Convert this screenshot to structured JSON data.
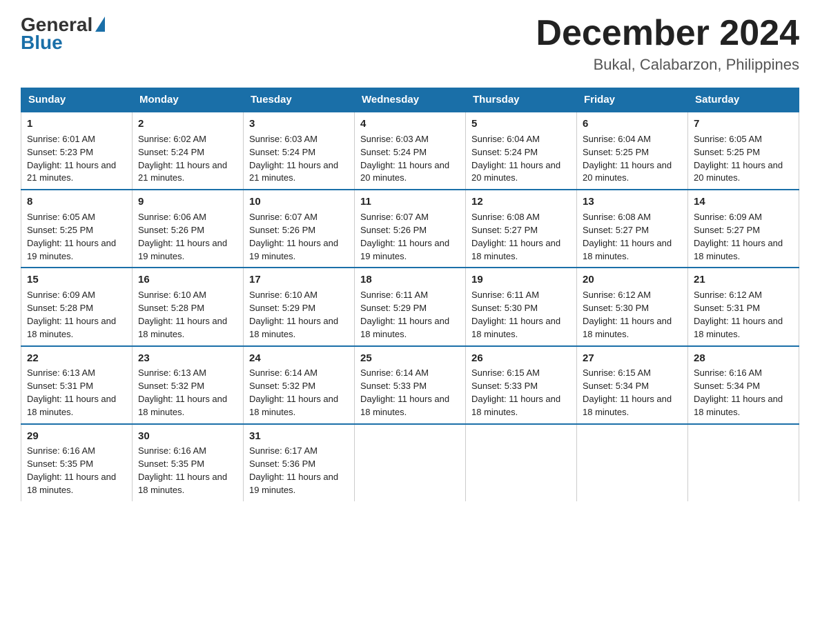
{
  "logo": {
    "general": "General",
    "blue": "Blue"
  },
  "title": {
    "month_year": "December 2024",
    "location": "Bukal, Calabarzon, Philippines"
  },
  "days_of_week": [
    "Sunday",
    "Monday",
    "Tuesday",
    "Wednesday",
    "Thursday",
    "Friday",
    "Saturday"
  ],
  "weeks": [
    [
      {
        "day": 1,
        "sunrise": "6:01 AM",
        "sunset": "5:23 PM",
        "daylight": "11 hours and 21 minutes."
      },
      {
        "day": 2,
        "sunrise": "6:02 AM",
        "sunset": "5:24 PM",
        "daylight": "11 hours and 21 minutes."
      },
      {
        "day": 3,
        "sunrise": "6:03 AM",
        "sunset": "5:24 PM",
        "daylight": "11 hours and 21 minutes."
      },
      {
        "day": 4,
        "sunrise": "6:03 AM",
        "sunset": "5:24 PM",
        "daylight": "11 hours and 20 minutes."
      },
      {
        "day": 5,
        "sunrise": "6:04 AM",
        "sunset": "5:24 PM",
        "daylight": "11 hours and 20 minutes."
      },
      {
        "day": 6,
        "sunrise": "6:04 AM",
        "sunset": "5:25 PM",
        "daylight": "11 hours and 20 minutes."
      },
      {
        "day": 7,
        "sunrise": "6:05 AM",
        "sunset": "5:25 PM",
        "daylight": "11 hours and 20 minutes."
      }
    ],
    [
      {
        "day": 8,
        "sunrise": "6:05 AM",
        "sunset": "5:25 PM",
        "daylight": "11 hours and 19 minutes."
      },
      {
        "day": 9,
        "sunrise": "6:06 AM",
        "sunset": "5:26 PM",
        "daylight": "11 hours and 19 minutes."
      },
      {
        "day": 10,
        "sunrise": "6:07 AM",
        "sunset": "5:26 PM",
        "daylight": "11 hours and 19 minutes."
      },
      {
        "day": 11,
        "sunrise": "6:07 AM",
        "sunset": "5:26 PM",
        "daylight": "11 hours and 19 minutes."
      },
      {
        "day": 12,
        "sunrise": "6:08 AM",
        "sunset": "5:27 PM",
        "daylight": "11 hours and 18 minutes."
      },
      {
        "day": 13,
        "sunrise": "6:08 AM",
        "sunset": "5:27 PM",
        "daylight": "11 hours and 18 minutes."
      },
      {
        "day": 14,
        "sunrise": "6:09 AM",
        "sunset": "5:27 PM",
        "daylight": "11 hours and 18 minutes."
      }
    ],
    [
      {
        "day": 15,
        "sunrise": "6:09 AM",
        "sunset": "5:28 PM",
        "daylight": "11 hours and 18 minutes."
      },
      {
        "day": 16,
        "sunrise": "6:10 AM",
        "sunset": "5:28 PM",
        "daylight": "11 hours and 18 minutes."
      },
      {
        "day": 17,
        "sunrise": "6:10 AM",
        "sunset": "5:29 PM",
        "daylight": "11 hours and 18 minutes."
      },
      {
        "day": 18,
        "sunrise": "6:11 AM",
        "sunset": "5:29 PM",
        "daylight": "11 hours and 18 minutes."
      },
      {
        "day": 19,
        "sunrise": "6:11 AM",
        "sunset": "5:30 PM",
        "daylight": "11 hours and 18 minutes."
      },
      {
        "day": 20,
        "sunrise": "6:12 AM",
        "sunset": "5:30 PM",
        "daylight": "11 hours and 18 minutes."
      },
      {
        "day": 21,
        "sunrise": "6:12 AM",
        "sunset": "5:31 PM",
        "daylight": "11 hours and 18 minutes."
      }
    ],
    [
      {
        "day": 22,
        "sunrise": "6:13 AM",
        "sunset": "5:31 PM",
        "daylight": "11 hours and 18 minutes."
      },
      {
        "day": 23,
        "sunrise": "6:13 AM",
        "sunset": "5:32 PM",
        "daylight": "11 hours and 18 minutes."
      },
      {
        "day": 24,
        "sunrise": "6:14 AM",
        "sunset": "5:32 PM",
        "daylight": "11 hours and 18 minutes."
      },
      {
        "day": 25,
        "sunrise": "6:14 AM",
        "sunset": "5:33 PM",
        "daylight": "11 hours and 18 minutes."
      },
      {
        "day": 26,
        "sunrise": "6:15 AM",
        "sunset": "5:33 PM",
        "daylight": "11 hours and 18 minutes."
      },
      {
        "day": 27,
        "sunrise": "6:15 AM",
        "sunset": "5:34 PM",
        "daylight": "11 hours and 18 minutes."
      },
      {
        "day": 28,
        "sunrise": "6:16 AM",
        "sunset": "5:34 PM",
        "daylight": "11 hours and 18 minutes."
      }
    ],
    [
      {
        "day": 29,
        "sunrise": "6:16 AM",
        "sunset": "5:35 PM",
        "daylight": "11 hours and 18 minutes."
      },
      {
        "day": 30,
        "sunrise": "6:16 AM",
        "sunset": "5:35 PM",
        "daylight": "11 hours and 18 minutes."
      },
      {
        "day": 31,
        "sunrise": "6:17 AM",
        "sunset": "5:36 PM",
        "daylight": "11 hours and 19 minutes."
      },
      null,
      null,
      null,
      null
    ]
  ]
}
